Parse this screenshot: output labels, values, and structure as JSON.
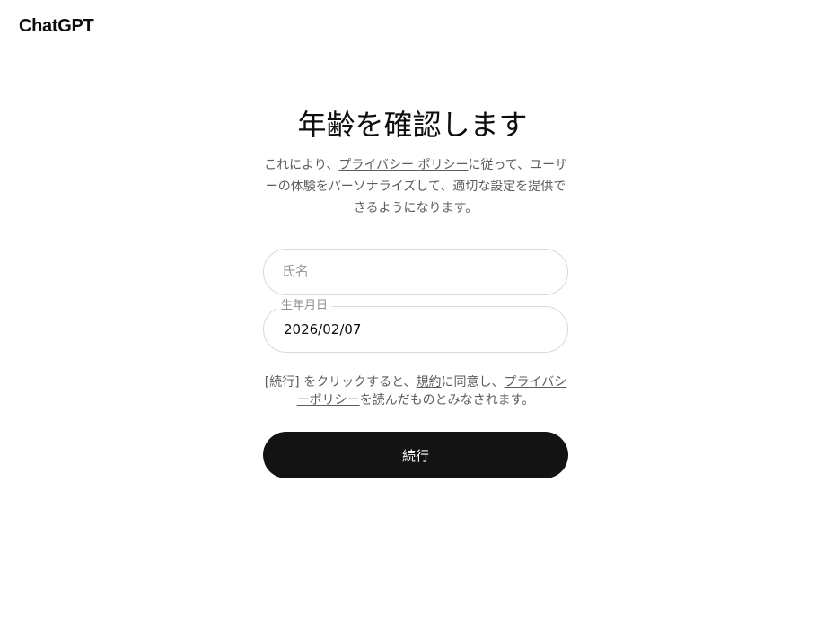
{
  "header": {
    "logo_text": "ChatGPT"
  },
  "main": {
    "title": "年齢を確認します",
    "description": {
      "before_link": "これにより、",
      "privacy_link": "プライバシー ポリシー",
      "after_link": "に従って、ユーザーの体験をパーソナライズして、適切な設定を提供できるようになります。"
    },
    "name_field": {
      "placeholder": "氏名",
      "value": ""
    },
    "dob_field": {
      "label": "生年月日",
      "value": "2026/02/07"
    },
    "terms": {
      "part1": "[続行] をクリックすると、",
      "terms_link": "規約",
      "part2": "に同意し、",
      "privacy_link": "プライバシーポリシー",
      "part3": "を読んだものとみなされます。"
    },
    "continue_label": "続行"
  },
  "colors": {
    "button_bg": "#131313",
    "button_text": "#ffffff",
    "muted_text": "#5d5d5d",
    "border": "#d9d9d9"
  }
}
